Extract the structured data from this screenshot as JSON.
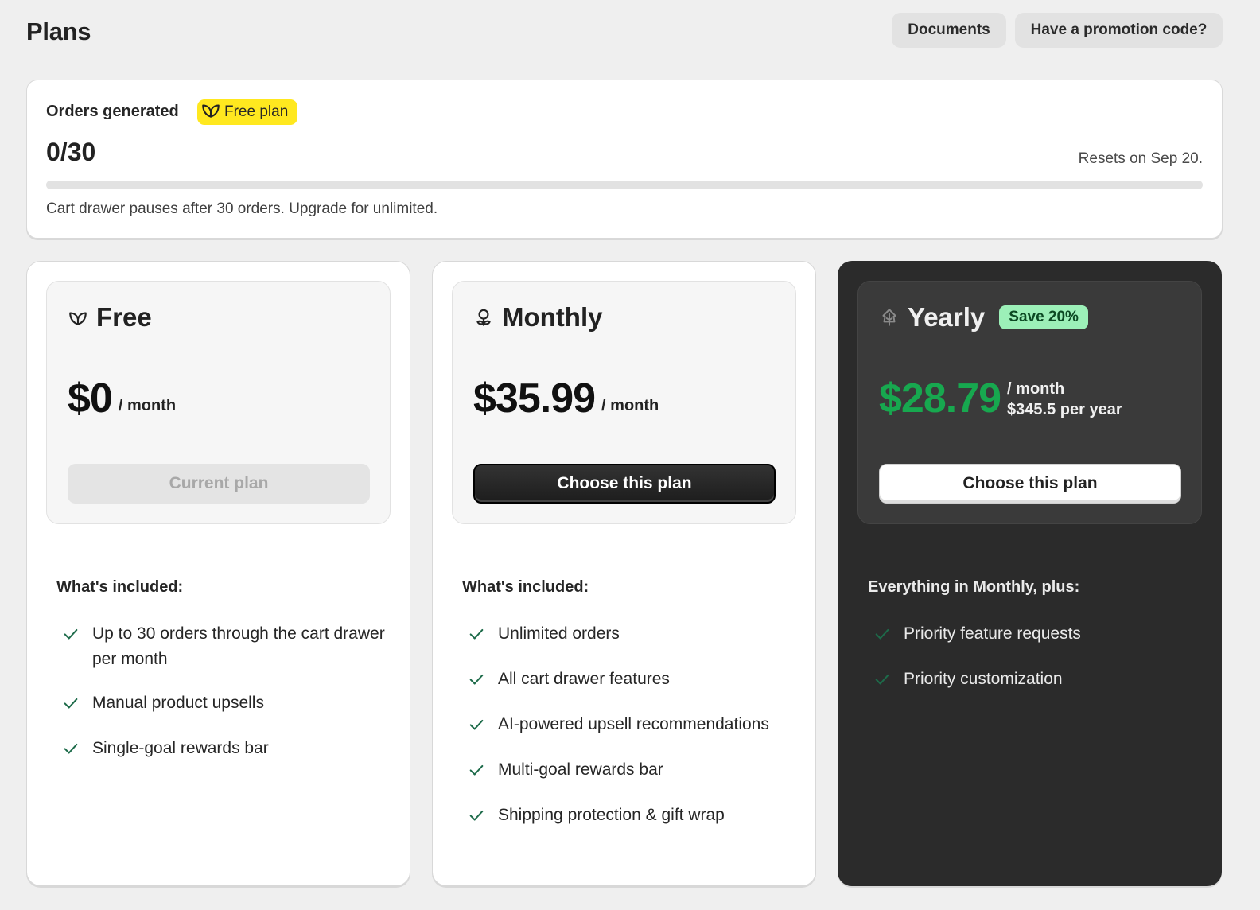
{
  "header": {
    "title": "Plans",
    "documents_label": "Documents",
    "promo_label": "Have a promotion code?"
  },
  "usage": {
    "label": "Orders generated",
    "badge": "Free plan",
    "badge_icon": "leaf-icon",
    "count": "0/30",
    "reset": "Resets on Sep 20.",
    "progress_fraction": 0,
    "note": "Cart drawer pauses after 30 orders. Upgrade for unlimited."
  },
  "plans": [
    {
      "icon": "leaf-icon",
      "name": "Free",
      "price": "$0",
      "per": "/ month",
      "button": "Current plan",
      "included_title": "What's included:",
      "features": [
        "Up to 30 orders through the cart drawer per month",
        "Manual product upsells",
        "Single-goal rewards bar"
      ]
    },
    {
      "icon": "sprout-icon",
      "name": "Monthly",
      "price": "$35.99",
      "per": "/ month",
      "button": "Choose this plan",
      "included_title": "What's included:",
      "features": [
        "Unlimited orders",
        "All cart drawer features",
        "AI-powered upsell recommendations",
        "Multi-goal rewards bar",
        "Shipping protection & gift wrap"
      ]
    },
    {
      "icon": "tree-icon",
      "name": "Yearly",
      "badge": "Save 20%",
      "price": "$28.79",
      "per": "/ month",
      "per_year": "$345.5 per year",
      "button": "Choose this plan",
      "included_title": "Everything in Monthly, plus:",
      "features": [
        "Priority feature requests",
        "Priority customization"
      ]
    }
  ],
  "colors": {
    "accent_green": "#17a84f",
    "badge_yellow": "#ffe81f",
    "save_badge_bg": "#9cf0b8",
    "check_green": "#1d6b4a",
    "dark_card": "#2b2b2b"
  }
}
